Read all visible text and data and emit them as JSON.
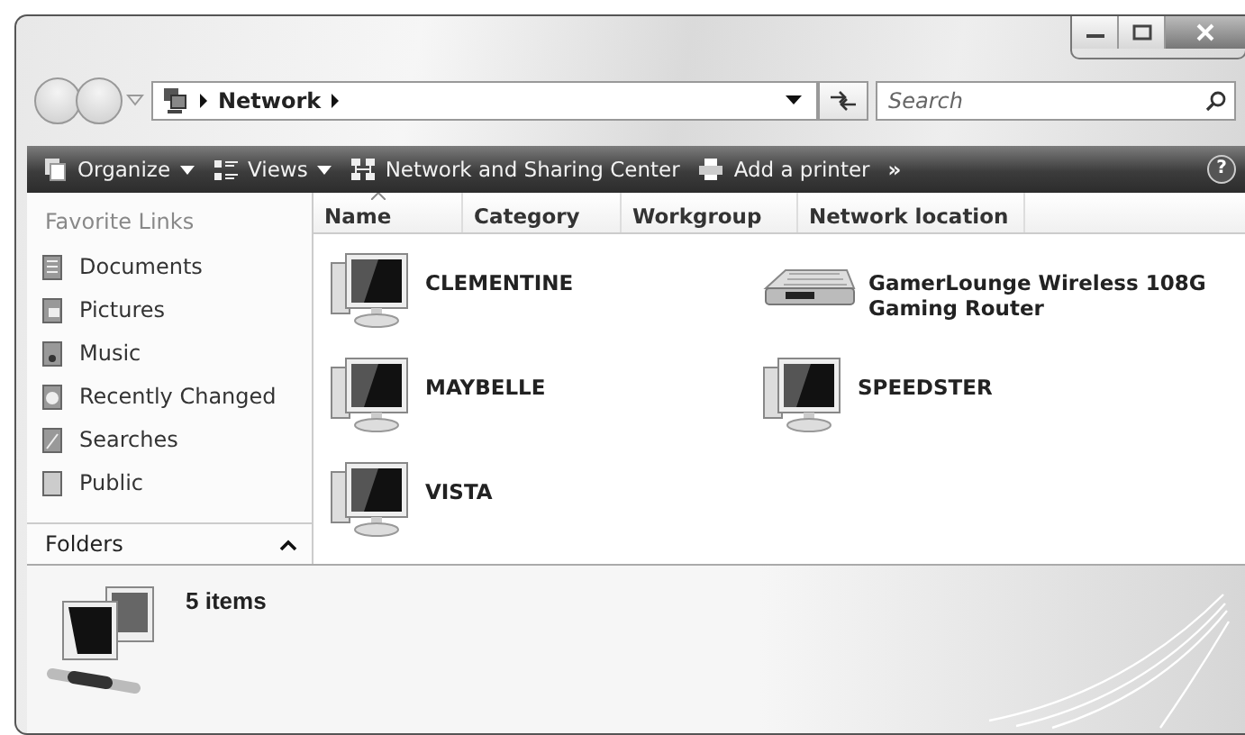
{
  "address_bar": {
    "path": [
      "Network"
    ]
  },
  "search": {
    "placeholder": "Search"
  },
  "toolbar": {
    "buttons": [
      {
        "label": "Organize",
        "kind": "menu"
      },
      {
        "label": "Views",
        "kind": "menu"
      },
      {
        "label": "Network and Sharing Center",
        "kind": "plain"
      },
      {
        "label": "Add a printer",
        "kind": "plain"
      },
      {
        "label": "»",
        "kind": "more"
      }
    ],
    "help": "?"
  },
  "sidebar": {
    "heading": "Favorite Links",
    "items": [
      {
        "label": "Documents"
      },
      {
        "label": "Pictures"
      },
      {
        "label": "Music"
      },
      {
        "label": "Recently Changed"
      },
      {
        "label": "Searches"
      },
      {
        "label": "Public"
      }
    ],
    "folders": {
      "label": "Folders",
      "expanded": false
    }
  },
  "columns": [
    {
      "label": "Name",
      "sorted": true
    },
    {
      "label": "Category",
      "sorted": false
    },
    {
      "label": "Workgroup",
      "sorted": false
    },
    {
      "label": "Network location",
      "sorted": false
    }
  ],
  "items": [
    {
      "name": "CLEMENTINE",
      "kind": "computer"
    },
    {
      "name": "GamerLounge Wireless 108G Gaming Router",
      "kind": "router"
    },
    {
      "name": "MAYBELLE",
      "kind": "computer"
    },
    {
      "name": "SPEEDSTER",
      "kind": "computer"
    },
    {
      "name": "VISTA",
      "kind": "computer"
    }
  ],
  "details": {
    "summary": "5 items"
  }
}
